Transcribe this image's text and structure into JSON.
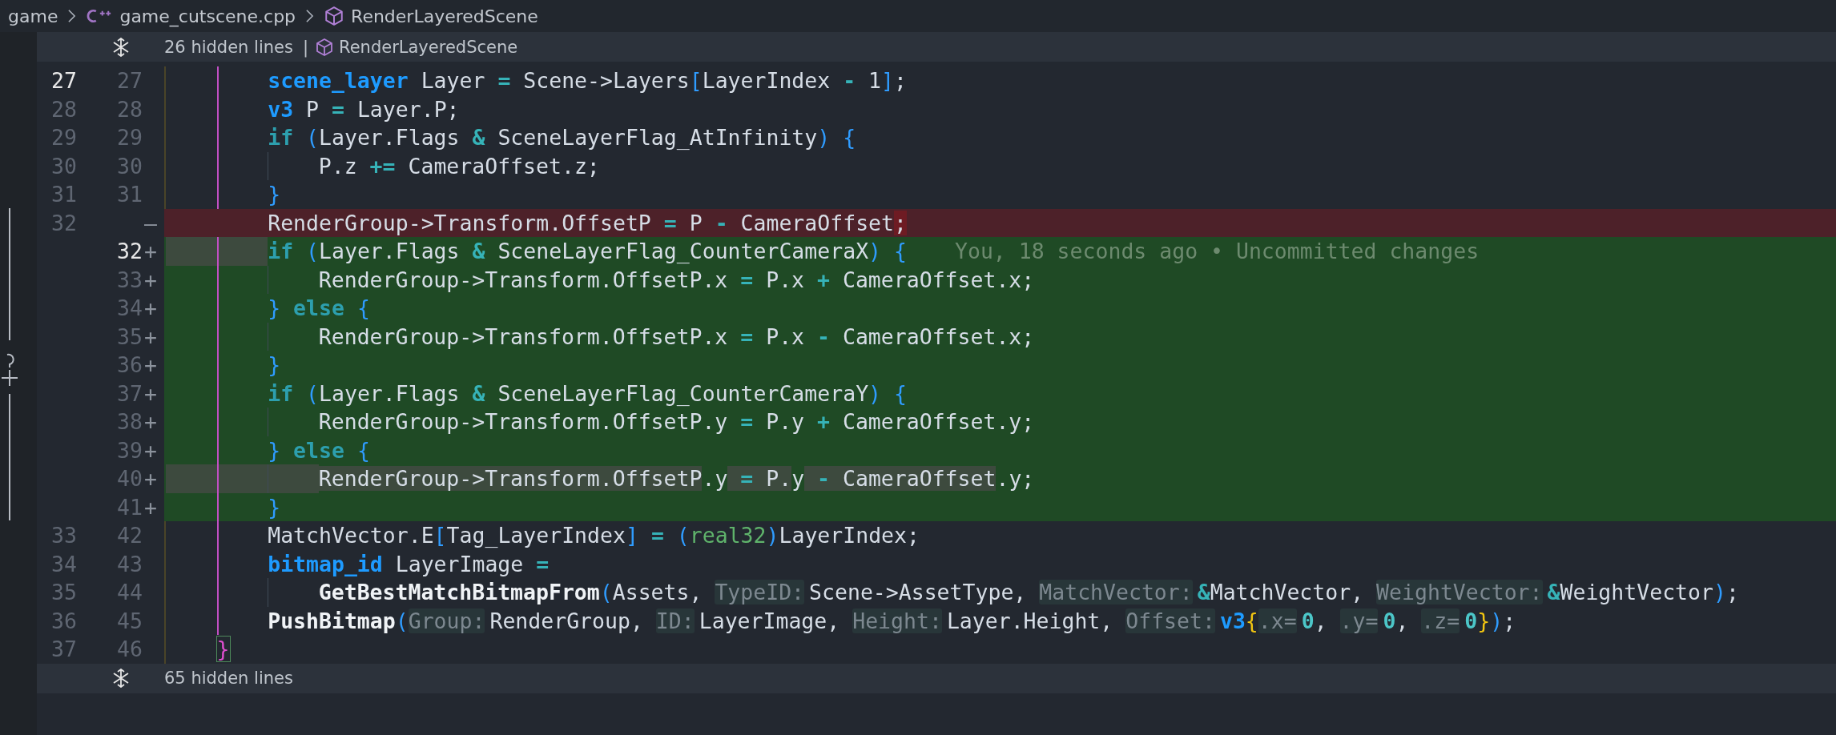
{
  "breadcrumb": [
    {
      "kind": "folder",
      "label": "game"
    },
    {
      "kind": "file",
      "label": "game_cutscene.cpp"
    },
    {
      "kind": "symbol",
      "label": "RenderLayeredScene"
    }
  ],
  "hidden_top": {
    "label": "26 hidden lines",
    "separator": "|",
    "symbol": "RenderLayeredScene"
  },
  "lines": [
    {
      "kind": "context",
      "old": "27",
      "new": "27",
      "current": true,
      "indent_guides": [
        {
          "kind": "none"
        },
        {
          "kind": "active"
        }
      ],
      "tokens": [
        {
          "kind": "type",
          "text": "scene_layer"
        },
        {
          "kind": "text",
          "text": " Layer "
        },
        {
          "kind": "op",
          "text": "="
        },
        {
          "kind": "text",
          "text": " Scene->Layers"
        },
        {
          "kind": "bracket",
          "text": "["
        },
        {
          "kind": "text",
          "text": "LayerIndex "
        },
        {
          "kind": "op",
          "text": "-"
        },
        {
          "kind": "text",
          "text": " 1"
        },
        {
          "kind": "bracket",
          "text": "]"
        },
        {
          "kind": "text",
          "text": ";"
        }
      ]
    },
    {
      "kind": "context",
      "old": "28",
      "new": "28",
      "current": false,
      "indent_guides": [
        {
          "kind": "none"
        },
        {
          "kind": "active"
        }
      ],
      "tokens": [
        {
          "kind": "type",
          "text": "v3"
        },
        {
          "kind": "text",
          "text": " P "
        },
        {
          "kind": "op",
          "text": "="
        },
        {
          "kind": "text",
          "text": " Layer.P;"
        }
      ]
    },
    {
      "kind": "context",
      "old": "29",
      "new": "29",
      "current": false,
      "indent_guides": [
        {
          "kind": "none"
        },
        {
          "kind": "active"
        }
      ],
      "tokens": [
        {
          "kind": "keyword",
          "text": "if "
        },
        {
          "kind": "bracket",
          "text": "("
        },
        {
          "kind": "text",
          "text": "Layer.Flags "
        },
        {
          "kind": "op",
          "text": "&"
        },
        {
          "kind": "text",
          "text": " SceneLayerFlag_AtInfinity"
        },
        {
          "kind": "bracket",
          "text": ") {"
        }
      ]
    },
    {
      "kind": "context",
      "old": "30",
      "new": "30",
      "current": false,
      "indent_guides": [
        {
          "kind": "none"
        },
        {
          "kind": "active"
        },
        {
          "kind": "plain"
        }
      ],
      "tokens": [
        {
          "kind": "text",
          "text": "P.z "
        },
        {
          "kind": "op",
          "text": "+="
        },
        {
          "kind": "text",
          "text": " CameraOffset.z;"
        }
      ]
    },
    {
      "kind": "context",
      "old": "31",
      "new": "31",
      "current": false,
      "indent_guides": [
        {
          "kind": "none"
        },
        {
          "kind": "active"
        }
      ],
      "tokens": [
        {
          "kind": "bracket",
          "text": "}"
        }
      ]
    },
    {
      "kind": "removed",
      "old": "32",
      "marker": "—",
      "current": false,
      "indent_guides": [
        {
          "kind": "none"
        },
        {
          "kind": "none"
        }
      ],
      "indent_changed": false,
      "tokens": [
        {
          "kind": "text",
          "text": "RenderGroup->Transform.OffsetP ",
          "changed": false
        },
        {
          "kind": "op",
          "text": "=",
          "changed": false
        },
        {
          "kind": "text",
          "text": " P ",
          "changed": false
        },
        {
          "kind": "op",
          "text": "-",
          "changed": false
        },
        {
          "kind": "text",
          "text": " CameraOffset",
          "changed": false
        },
        {
          "kind": "text",
          "text": ";",
          "changed": true
        }
      ]
    },
    {
      "kind": "added",
      "new": "32",
      "marker": "+",
      "current": true,
      "indent_guides": [
        {
          "kind": "none"
        },
        {
          "kind": "active"
        }
      ],
      "indent_changed": true,
      "blame": "You, 18 seconds ago • Uncommitted changes",
      "tokens": [
        {
          "kind": "keyword",
          "text": "if ",
          "changed": false
        },
        {
          "kind": "bracket",
          "text": "(",
          "changed": false
        },
        {
          "kind": "text",
          "text": "Layer.Flags ",
          "changed": false
        },
        {
          "kind": "op",
          "text": "&",
          "changed": false
        },
        {
          "kind": "text",
          "text": " SceneLayerFlag_CounterCameraX",
          "changed": false
        },
        {
          "kind": "bracket",
          "text": ") {",
          "changed": false
        }
      ]
    },
    {
      "kind": "added",
      "new": "33",
      "marker": "+",
      "current": false,
      "indent_guides": [
        {
          "kind": "none"
        },
        {
          "kind": "active"
        },
        {
          "kind": "plain"
        }
      ],
      "indent_changed": false,
      "tokens": [
        {
          "kind": "text",
          "text": "RenderGroup->Transform.OffsetP.x "
        },
        {
          "kind": "op",
          "text": "="
        },
        {
          "kind": "text",
          "text": " P.x "
        },
        {
          "kind": "op",
          "text": "+"
        },
        {
          "kind": "text",
          "text": " CameraOffset.x;"
        }
      ]
    },
    {
      "kind": "added",
      "new": "34",
      "marker": "+",
      "current": false,
      "indent_guides": [
        {
          "kind": "none"
        },
        {
          "kind": "active"
        }
      ],
      "indent_changed": false,
      "tokens": [
        {
          "kind": "bracket",
          "text": "} "
        },
        {
          "kind": "keyword",
          "text": "else "
        },
        {
          "kind": "bracket",
          "text": "{"
        }
      ]
    },
    {
      "kind": "added",
      "new": "35",
      "marker": "+",
      "current": false,
      "indent_guides": [
        {
          "kind": "none"
        },
        {
          "kind": "active"
        },
        {
          "kind": "plain"
        }
      ],
      "indent_changed": false,
      "tokens": [
        {
          "kind": "text",
          "text": "RenderGroup->Transform.OffsetP.x "
        },
        {
          "kind": "op",
          "text": "="
        },
        {
          "kind": "text",
          "text": " P.x "
        },
        {
          "kind": "op",
          "text": "-"
        },
        {
          "kind": "text",
          "text": " CameraOffset.x;"
        }
      ]
    },
    {
      "kind": "added",
      "new": "36",
      "marker": "+",
      "current": false,
      "indent_guides": [
        {
          "kind": "none"
        },
        {
          "kind": "active"
        }
      ],
      "indent_changed": false,
      "tokens": [
        {
          "kind": "bracket",
          "text": "}"
        }
      ]
    },
    {
      "kind": "added",
      "new": "37",
      "marker": "+",
      "current": false,
      "indent_guides": [
        {
          "kind": "none"
        },
        {
          "kind": "active"
        }
      ],
      "indent_changed": false,
      "tokens": [
        {
          "kind": "keyword",
          "text": "if "
        },
        {
          "kind": "bracket",
          "text": "("
        },
        {
          "kind": "text",
          "text": "Layer.Flags "
        },
        {
          "kind": "op",
          "text": "&"
        },
        {
          "kind": "text",
          "text": " SceneLayerFlag_CounterCameraY"
        },
        {
          "kind": "bracket",
          "text": ") {"
        }
      ]
    },
    {
      "kind": "added",
      "new": "38",
      "marker": "+",
      "current": false,
      "indent_guides": [
        {
          "kind": "none"
        },
        {
          "kind": "active"
        },
        {
          "kind": "plain"
        }
      ],
      "indent_changed": false,
      "tokens": [
        {
          "kind": "text",
          "text": "RenderGroup->Transform.OffsetP.y "
        },
        {
          "kind": "op",
          "text": "="
        },
        {
          "kind": "text",
          "text": " P.y "
        },
        {
          "kind": "op",
          "text": "+"
        },
        {
          "kind": "text",
          "text": " CameraOffset.y;"
        }
      ]
    },
    {
      "kind": "added",
      "new": "39",
      "marker": "+",
      "current": false,
      "indent_guides": [
        {
          "kind": "none"
        },
        {
          "kind": "active"
        }
      ],
      "indent_changed": false,
      "tokens": [
        {
          "kind": "bracket",
          "text": "} "
        },
        {
          "kind": "keyword",
          "text": "else "
        },
        {
          "kind": "bracket",
          "text": "{"
        }
      ]
    },
    {
      "kind": "added",
      "new": "40",
      "marker": "+",
      "current": false,
      "indent_guides": [
        {
          "kind": "none"
        },
        {
          "kind": "active"
        },
        {
          "kind": "plain"
        }
      ],
      "indent_changed": true,
      "tokens": [
        {
          "kind": "text",
          "text": "RenderGroup->Transform.OffsetP",
          "changed": true
        },
        {
          "kind": "text",
          "text": ".y",
          "changed": false
        },
        {
          "kind": "op",
          "text": " = ",
          "changed": true
        },
        {
          "kind": "text",
          "text": "P.",
          "changed": true
        },
        {
          "kind": "text",
          "text": "y",
          "changed": false
        },
        {
          "kind": "op",
          "text": " - ",
          "changed": true
        },
        {
          "kind": "text",
          "text": "CameraOffset",
          "changed": true
        },
        {
          "kind": "text",
          "text": ".y;",
          "changed": false
        }
      ]
    },
    {
      "kind": "added",
      "new": "41",
      "marker": "+",
      "current": false,
      "indent_guides": [
        {
          "kind": "none"
        },
        {
          "kind": "active"
        }
      ],
      "indent_changed": false,
      "tokens": [
        {
          "kind": "bracket",
          "text": "}"
        }
      ]
    },
    {
      "kind": "context",
      "old": "33",
      "new": "42",
      "current": false,
      "indent_guides": [
        {
          "kind": "none"
        },
        {
          "kind": "active"
        }
      ],
      "tokens": [
        {
          "kind": "text",
          "text": "MatchVector.E"
        },
        {
          "kind": "bracket",
          "text": "["
        },
        {
          "kind": "text",
          "text": "Tag_LayerIndex"
        },
        {
          "kind": "bracket",
          "text": "]"
        },
        {
          "kind": "op",
          "text": " = "
        },
        {
          "kind": "bracket",
          "text": "("
        },
        {
          "kind": "cast",
          "text": "real32"
        },
        {
          "kind": "bracket",
          "text": ")"
        },
        {
          "kind": "text",
          "text": "LayerIndex;"
        }
      ]
    },
    {
      "kind": "context",
      "old": "34",
      "new": "43",
      "current": false,
      "indent_guides": [
        {
          "kind": "none"
        },
        {
          "kind": "active"
        }
      ],
      "tokens": [
        {
          "kind": "type",
          "text": "bitmap_id"
        },
        {
          "kind": "text",
          "text": " LayerImage "
        },
        {
          "kind": "op",
          "text": "="
        }
      ]
    },
    {
      "kind": "context",
      "old": "35",
      "new": "44",
      "current": false,
      "indent_guides": [
        {
          "kind": "none"
        },
        {
          "kind": "active"
        },
        {
          "kind": "plain"
        }
      ],
      "tokens": [
        {
          "kind": "func",
          "text": "GetBestMatchBitmapFrom"
        },
        {
          "kind": "bracket",
          "text": "("
        },
        {
          "kind": "text",
          "text": "Assets, "
        },
        {
          "kind": "hint",
          "text": "TypeID:"
        },
        {
          "kind": "text",
          "text": "Scene->AssetType, "
        },
        {
          "kind": "hint",
          "text": "MatchVector:"
        },
        {
          "kind": "op",
          "text": "&"
        },
        {
          "kind": "text",
          "text": "MatchVector, "
        },
        {
          "kind": "hint",
          "text": "WeightVector:"
        },
        {
          "kind": "op",
          "text": "&"
        },
        {
          "kind": "text",
          "text": "WeightVector"
        },
        {
          "kind": "bracket",
          "text": ")"
        },
        {
          "kind": "text",
          "text": ";"
        }
      ]
    },
    {
      "kind": "context",
      "old": "36",
      "new": "45",
      "current": false,
      "indent_guides": [
        {
          "kind": "none"
        },
        {
          "kind": "active"
        }
      ],
      "tokens": [
        {
          "kind": "func",
          "text": "PushBitmap"
        },
        {
          "kind": "bracket",
          "text": "("
        },
        {
          "kind": "hint",
          "text": "Group:"
        },
        {
          "kind": "text",
          "text": "RenderGroup, "
        },
        {
          "kind": "hint",
          "text": "ID:"
        },
        {
          "kind": "text",
          "text": "LayerImage, "
        },
        {
          "kind": "hint",
          "text": "Height:"
        },
        {
          "kind": "text",
          "text": "Layer.Height, "
        },
        {
          "kind": "hint",
          "text": "Offset:"
        },
        {
          "kind": "type",
          "text": "v3"
        },
        {
          "kind": "bracket2",
          "text": "{"
        },
        {
          "kind": "hint",
          "text": ".x="
        },
        {
          "kind": "number",
          "text": "0"
        },
        {
          "kind": "text",
          "text": ", "
        },
        {
          "kind": "hint",
          "text": ".y="
        },
        {
          "kind": "number",
          "text": "0"
        },
        {
          "kind": "text",
          "text": ", "
        },
        {
          "kind": "hint",
          "text": ".z="
        },
        {
          "kind": "number",
          "text": "0"
        },
        {
          "kind": "bracket2",
          "text": "}"
        },
        {
          "kind": "bracket",
          "text": ")"
        },
        {
          "kind": "text",
          "text": ";"
        }
      ]
    },
    {
      "kind": "context",
      "old": "37",
      "new": "46",
      "current": false,
      "indent_guides": [
        {
          "kind": "none"
        }
      ],
      "tokens": [
        {
          "kind": "bracket_active",
          "text": "}"
        }
      ]
    }
  ],
  "hidden_bottom": {
    "label": "65 hidden lines"
  }
}
